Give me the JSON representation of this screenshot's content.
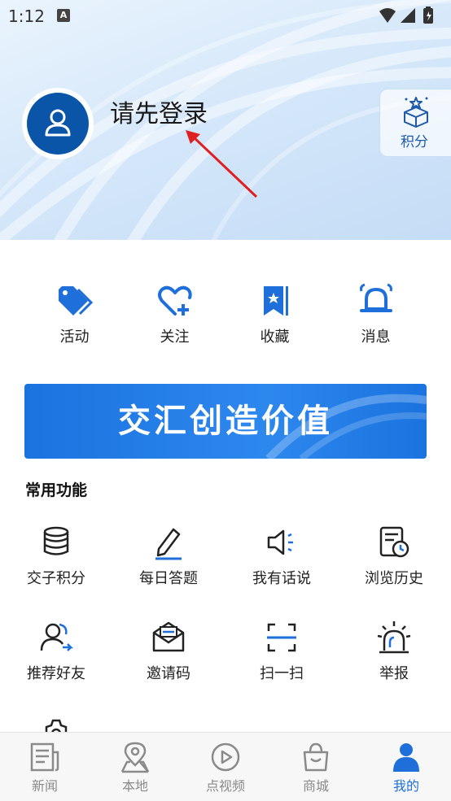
{
  "status_bar": {
    "time": "1:12",
    "notif_badge": "A"
  },
  "profile": {
    "login_prompt": "请先登录",
    "points_label": "积分"
  },
  "quick_actions": [
    {
      "label": "活动",
      "icon": "tag-icon"
    },
    {
      "label": "关注",
      "icon": "heart-plus-icon"
    },
    {
      "label": "收藏",
      "icon": "bookmark-star-icon"
    },
    {
      "label": "消息",
      "icon": "bell-icon"
    }
  ],
  "banner": {
    "text": "交汇创造价值"
  },
  "section": {
    "title": "常用功能"
  },
  "functions": [
    {
      "label": "交子积分",
      "icon": "coin-stack-icon"
    },
    {
      "label": "每日答题",
      "icon": "pencil-icon"
    },
    {
      "label": "我有话说",
      "icon": "speaker-icon"
    },
    {
      "label": "浏览历史",
      "icon": "history-icon"
    },
    {
      "label": "推荐好友",
      "icon": "recommend-friend-icon"
    },
    {
      "label": "邀请码",
      "icon": "envelope-icon"
    },
    {
      "label": "扫一扫",
      "icon": "scan-icon"
    },
    {
      "label": "举报",
      "icon": "alarm-icon"
    }
  ],
  "tabs": [
    {
      "label": "新闻",
      "icon": "news-icon"
    },
    {
      "label": "本地",
      "icon": "location-icon"
    },
    {
      "label": "点视频",
      "icon": "play-icon"
    },
    {
      "label": "商城",
      "icon": "shopping-bag-icon"
    },
    {
      "label": "我的",
      "icon": "person-icon",
      "active": true
    }
  ],
  "colors": {
    "accent": "#1e6fd9",
    "avatar": "#0b55a8",
    "banner": "#2d88ee",
    "arrow": "#e02020"
  }
}
